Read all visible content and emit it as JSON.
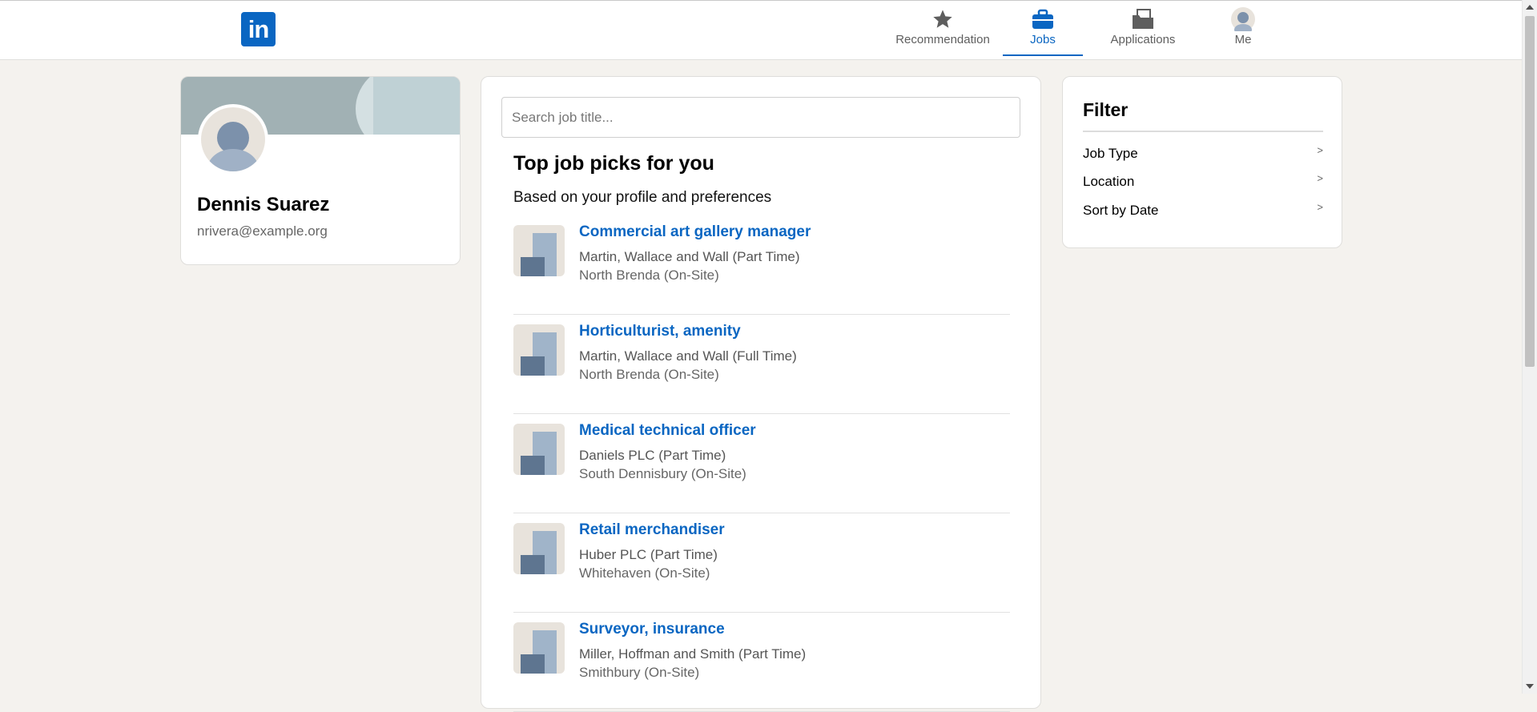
{
  "brand": {
    "logo_text": "in",
    "color": "#0a66c2"
  },
  "nav": {
    "recommendation": "Recommendation",
    "jobs": "Jobs",
    "applications": "Applications",
    "me": "Me"
  },
  "profile": {
    "name": "Dennis Suarez",
    "email": "nrivera@example.org"
  },
  "search": {
    "placeholder": "Search job title..."
  },
  "jobs": {
    "title": "Top job picks for you",
    "subtitle": "Based on your profile and preferences",
    "items": [
      {
        "title": "Commercial art gallery manager",
        "company": "Martin, Wallace and Wall (Part Time)",
        "location": "North Brenda (On-Site)"
      },
      {
        "title": "Horticulturist, amenity",
        "company": "Martin, Wallace and Wall (Full Time)",
        "location": "North Brenda (On-Site)"
      },
      {
        "title": "Medical technical officer",
        "company": "Daniels PLC (Part Time)",
        "location": "South Dennisbury (On-Site)"
      },
      {
        "title": "Retail merchandiser",
        "company": "Huber PLC (Part Time)",
        "location": "Whitehaven (On-Site)"
      },
      {
        "title": "Surveyor, insurance",
        "company": "Miller, Hoffman and Smith (Part Time)",
        "location": "Smithbury (On-Site)"
      }
    ]
  },
  "filter": {
    "title": "Filter",
    "options": [
      {
        "label": "Job Type",
        "arrow": ">"
      },
      {
        "label": "Location",
        "arrow": ">"
      },
      {
        "label": "Sort by Date",
        "arrow": ">"
      }
    ]
  }
}
